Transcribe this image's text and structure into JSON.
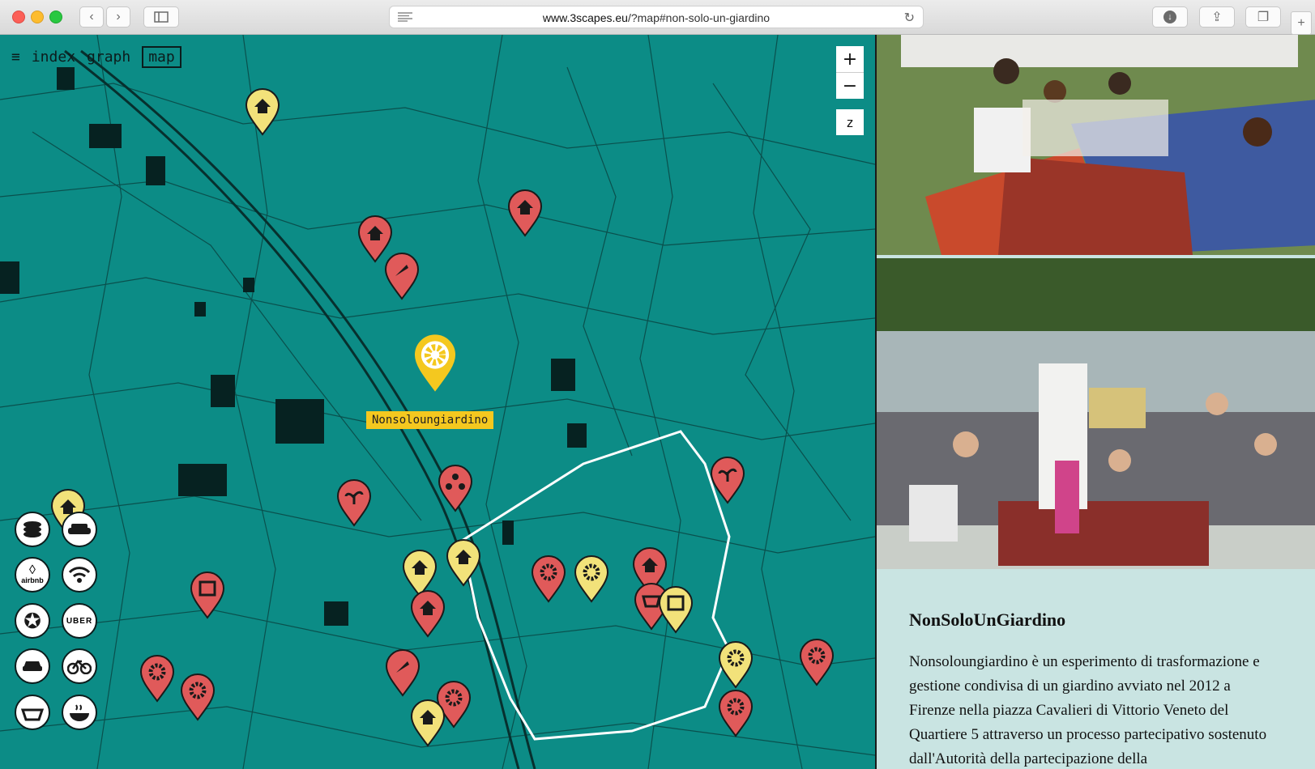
{
  "browser": {
    "url_domain": "www.3scapes.eu",
    "url_rest": "/?map#non-solo-un-giardino"
  },
  "nav": {
    "logo": "≡",
    "items": [
      "index",
      "graph",
      "map"
    ],
    "active": "map"
  },
  "map_controls": {
    "zoom_in": "+",
    "zoom_out": "−",
    "z_label": "z"
  },
  "selected_marker": {
    "label": "Nonsoloungiardino",
    "icon": "gear-icon",
    "color": "#f4c81f"
  },
  "colors": {
    "map_bg": "#0c8c86",
    "marker_red": "#e05a5a",
    "marker_yellow": "#f2e27a",
    "route": "#ffffff"
  },
  "category_icons": [
    "coins-icon",
    "sofa-icon",
    "airbnb-icon",
    "wifi-icon",
    "star-icon",
    "uber-icon",
    "car-icon",
    "bicycle-icon",
    "basket-icon",
    "food-icon"
  ],
  "category_labels": {
    "airbnb": "airbnb",
    "uber": "UBER"
  },
  "panel": {
    "title": "NonSoloUnGiardino",
    "body": "Nonsoloungiardino è un esperimento di trasformazione e gestione condivisa di un giardino avviato nel 2012 a Firenze nella piazza Cavalieri di Vittorio Veneto del Quartiere 5 attraverso un processo partecipativo sostenuto dall'Autorità della partecipazione della"
  }
}
